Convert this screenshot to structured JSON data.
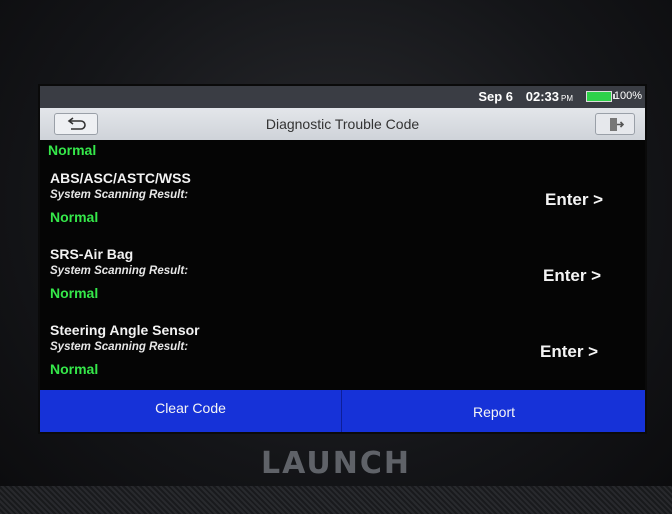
{
  "status_bar": {
    "date": "Sep 6",
    "time": "02:33",
    "ampm": "PM",
    "battery": "100%"
  },
  "header": {
    "title": "Diagnostic Trouble Code",
    "back_icon": "back-arrow-icon",
    "exit_icon": "exit-icon"
  },
  "top_partial_status": "Normal",
  "systems": [
    {
      "name": "ABS/ASC/ASTC/WSS",
      "subtitle": "System Scanning Result:",
      "status": "Normal",
      "enter": "Enter >"
    },
    {
      "name": "SRS-Air Bag",
      "subtitle": "System Scanning Result:",
      "status": "Normal",
      "enter": "Enter >"
    },
    {
      "name": "Steering Angle Sensor",
      "subtitle": "System Scanning Result:",
      "status": "Normal",
      "enter": "Enter >"
    }
  ],
  "actions": {
    "clear_code": "Clear Code",
    "report": "Report"
  },
  "device": {
    "brand": "LAUNCH"
  },
  "colors": {
    "normal_green": "#35e84a",
    "action_blue": "#1632d8",
    "header_gray": "#d8dbe0"
  }
}
